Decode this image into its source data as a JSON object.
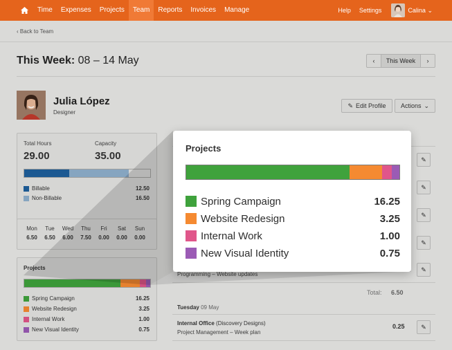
{
  "nav": {
    "items": [
      "Time",
      "Expenses",
      "Projects",
      "Team",
      "Reports",
      "Invoices",
      "Manage"
    ],
    "active": "Team",
    "help": "Help",
    "settings": "Settings",
    "user": "Calina"
  },
  "back_link": "Back to Team",
  "week": {
    "prefix": "This Week:",
    "range": "08 – 14 May",
    "this_week": "This Week"
  },
  "person": {
    "name": "Julia López",
    "role": "Designer",
    "edit_profile": "Edit Profile",
    "actions": "Actions"
  },
  "hours": {
    "total_label": "Total Hours",
    "total": "29.00",
    "capacity_label": "Capacity",
    "capacity": "35.00",
    "billable_label": "Billable",
    "billable": "12.50",
    "non_billable_label": "Non-Billable",
    "non_billable": "16.50",
    "billable_fraction": 0.357,
    "non_billable_fraction": 0.471
  },
  "days": [
    {
      "name": "Mon",
      "value": "6.50"
    },
    {
      "name": "Tue",
      "value": "6.50"
    },
    {
      "name": "Wed",
      "value": "6.00"
    },
    {
      "name": "Thu",
      "value": "7.50"
    },
    {
      "name": "Fri",
      "value": "0.00"
    },
    {
      "name": "Sat",
      "value": "0.00"
    },
    {
      "name": "Sun",
      "value": "0.00"
    }
  ],
  "projects": {
    "title": "Projects",
    "items": [
      {
        "name": "Spring Campaign",
        "value": "16.25",
        "hours": 16.25,
        "color": "#3fa23c"
      },
      {
        "name": "Website Redesign",
        "value": "3.25",
        "hours": 3.25,
        "color": "#f58a31"
      },
      {
        "name": "Internal Work",
        "value": "1.00",
        "hours": 1.0,
        "color": "#e0568a"
      },
      {
        "name": "New Visual Identity",
        "value": "0.75",
        "hours": 0.75,
        "color": "#9b5bb5"
      }
    ]
  },
  "entries": {
    "entry1_task": "Programming",
    "entry1_sep": "–",
    "entry1_note": "Website updates",
    "total_label": "Total:",
    "total_value": "6.50",
    "day_heading": "Tuesday",
    "day_date": "09 May",
    "entry2_project": "Internal Office",
    "entry2_client": "(Discovery Designs)",
    "entry2_task": "Project Management",
    "entry2_sep": "–",
    "entry2_note": "Week plan",
    "entry2_value": "0.25"
  },
  "colors": {
    "brand": "#e5641c",
    "billable": "#1e5f9c",
    "non_billable": "#8fb0cc"
  }
}
